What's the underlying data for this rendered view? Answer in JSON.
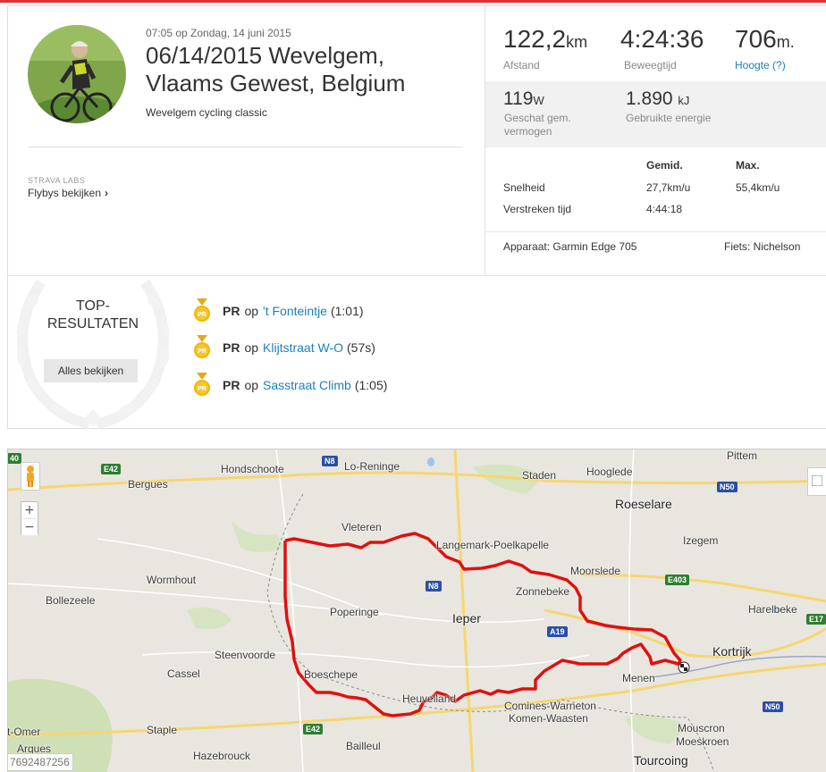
{
  "activity": {
    "datetime": "07:05 op Zondag, 14 juni 2015",
    "title_line1": "06/14/2015 Wevelgem,",
    "title_line2": "Vlaams Gewest, Belgium",
    "description": "Wevelgem cycling classic",
    "labs_tag": "STRAVA LABS",
    "flyby_label": "Flybys bekijken",
    "flyby_chevron": "›"
  },
  "stats": {
    "distance": {
      "value": "122,2",
      "unit": "km",
      "label": "Afstand"
    },
    "moving_time": {
      "value": "4:24:36",
      "label": "Beweegtijd"
    },
    "elevation": {
      "value": "706",
      "unit": "m.",
      "label": "Hoogte (?)"
    },
    "power": {
      "value": "119",
      "unit": "W",
      "label_line1": "Geschat gem.",
      "label_line2": "vermogen"
    },
    "energy": {
      "value": "1.890",
      "unit": "kJ",
      "label": "Gebruikte energie"
    }
  },
  "table": {
    "col_avg": "Gemid.",
    "col_max": "Max.",
    "rows": [
      {
        "label": "Snelheid",
        "avg": "27,7km/u",
        "max": "55,4km/u"
      },
      {
        "label": "Verstreken tijd",
        "avg": "4:44:18",
        "max": ""
      }
    ]
  },
  "device": "Apparaat: Garmin Edge 705",
  "bike": "Fiets: Nichelson",
  "top_results": {
    "title_line1": "TOP-",
    "title_line2": "RESULTATEN",
    "view_all": "Alles bekijken",
    "medal_text": "PR",
    "items": [
      {
        "pr": "PR",
        "op": "op",
        "segment": "'t Fonteintje",
        "time": "(1:01)"
      },
      {
        "pr": "PR",
        "op": "op",
        "segment": "Klijtstraat W-O",
        "time": "(57s)"
      },
      {
        "pr": "PR",
        "op": "op",
        "segment": "Sasstraat Climb",
        "time": "(1:05)"
      }
    ]
  },
  "map": {
    "zoom_in": "+",
    "zoom_out": "−",
    "map_id": "7692487256",
    "route_color": "#e01010",
    "towns": {
      "hondschoote": "Hondschoote",
      "lo_reninge": "Lo-Reninge",
      "staden": "Staden",
      "hooglede": "Hooglede",
      "pittem": "Pittem",
      "bergues": "Bergues",
      "roeselare": "Roeselare",
      "vleteren": "Vleteren",
      "langemark": "Langemark-Poelkapelle",
      "izegem": "Izegem",
      "moorslede": "Moorslede",
      "wormhout": "Wormhout",
      "bollezeele": "Bollezeele",
      "zonnebeke": "Zonnebeke",
      "harelbeke": "Harelbeke",
      "poperinge": "Poperinge",
      "ieper": "Ieper",
      "steenvoorde": "Steenvoorde",
      "kortrijk": "Kortrijk",
      "cassel": "Cassel",
      "boeschepe": "Boeschepe",
      "menen": "Menen",
      "heuvelland": "Heuvelland",
      "comines": "Comines-Warneton",
      "komen": "Komen-Waasten",
      "staple": "Staple",
      "mouscron": "Mouscron",
      "moeskroen": "Moeskroen",
      "omer": "t-Omer",
      "arques": "Arques",
      "hazebrouck": "Hazebrouck",
      "bailleul": "Bailleul",
      "tourcoing": "Tourcoing"
    },
    "roads": {
      "e42a": "E42",
      "n8a": "N8",
      "n50a": "N50",
      "e403": "E403",
      "n8b": "N8",
      "a19": "A19",
      "e17": "E17",
      "e42b": "E42",
      "n50b": "N50",
      "r40": "40"
    }
  }
}
